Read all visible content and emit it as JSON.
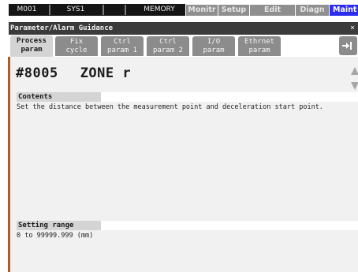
{
  "status_bar": {
    "cells": [
      "M001",
      "SYS1",
      "",
      "MEMORY"
    ],
    "menus": [
      {
        "label": "Monitr",
        "active": false
      },
      {
        "label": "Setup",
        "active": false
      },
      {
        "label": "Edit",
        "active": false
      },
      {
        "label": "Diagn",
        "active": false
      },
      {
        "label": "Maint",
        "active": true
      }
    ]
  },
  "window": {
    "title": "Parameter/Alarm Guidance",
    "close_glyph": "×"
  },
  "tabs": [
    {
      "line1": "Process",
      "line2": "param",
      "active": true
    },
    {
      "line1": "Fix",
      "line2": "cycle",
      "active": false
    },
    {
      "line1": "Ctrl",
      "line2": "param 1",
      "active": false
    },
    {
      "line1": "Ctrl",
      "line2": "param 2",
      "active": false
    },
    {
      "line1": "I/O",
      "line2": "param",
      "active": false
    },
    {
      "line1": "Ethrnet",
      "line2": "param",
      "active": false
    }
  ],
  "parameter": {
    "number": "#8005",
    "name": "ZONE r"
  },
  "contents": {
    "heading": "Contents",
    "text": "Set the distance between the measurement point and deceleration start point."
  },
  "setting_range": {
    "heading": "Setting range",
    "text": "0 to 99999.999 (mm)"
  },
  "icons": {
    "export": "export-icon",
    "scroll_up": "scroll-up-icon",
    "scroll_down": "scroll-down-icon"
  },
  "colors": {
    "active_menu": "#2d2df0",
    "title_bar": "#3b3b3b",
    "panel_bg": "#f1f1f1",
    "accent_stripe": "#b05a2a"
  }
}
